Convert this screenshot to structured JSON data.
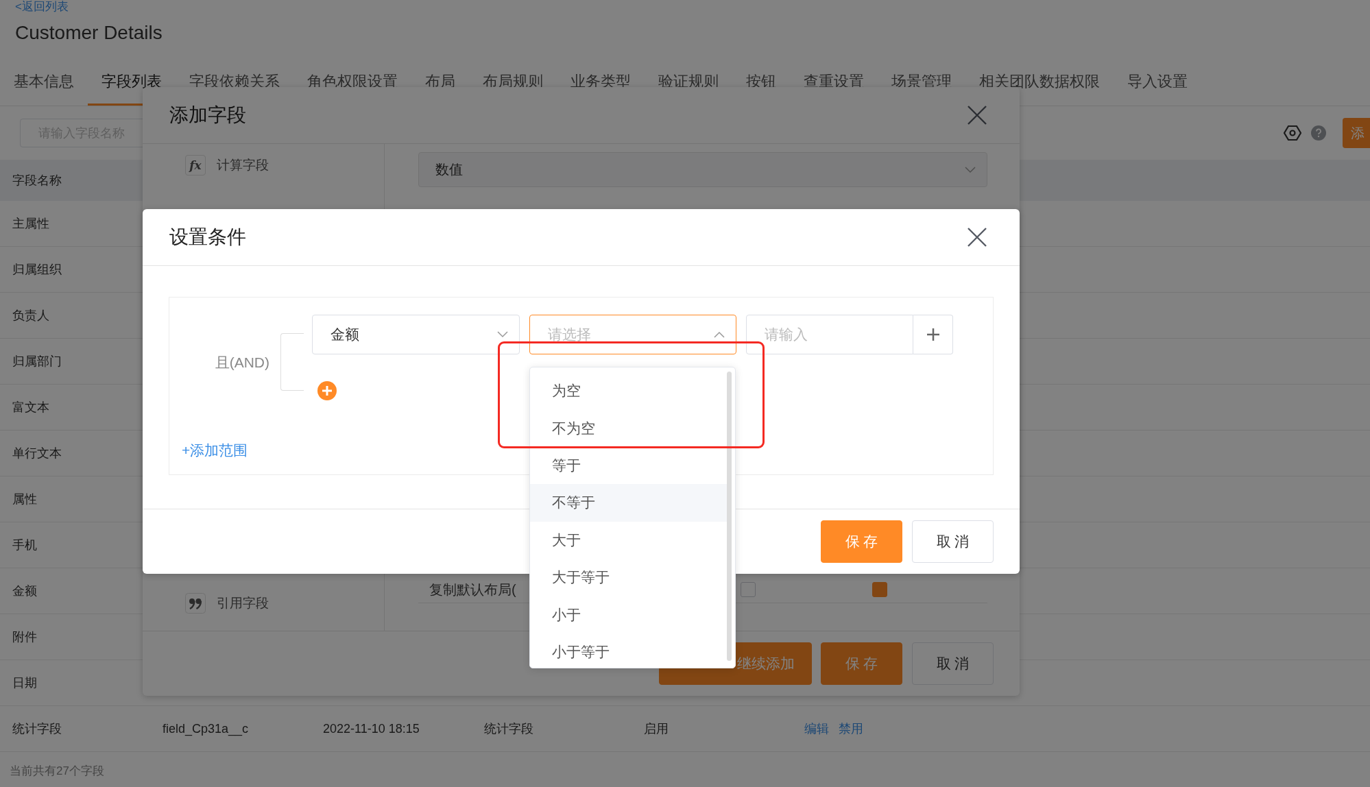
{
  "page": {
    "back_link": "<返回列表",
    "title": "Customer Details",
    "tabs": [
      {
        "label": "基本信息",
        "selected": false
      },
      {
        "label": "字段列表",
        "selected": true
      },
      {
        "label": "字段依赖关系",
        "selected": false
      },
      {
        "label": "角色权限设置",
        "selected": false
      },
      {
        "label": "布局",
        "selected": false
      },
      {
        "label": "布局规则",
        "selected": false
      },
      {
        "label": "业务类型",
        "selected": false
      },
      {
        "label": "验证规则",
        "selected": false
      },
      {
        "label": "按钮",
        "selected": false
      },
      {
        "label": "查重设置",
        "selected": false
      },
      {
        "label": "场景管理",
        "selected": false
      },
      {
        "label": "相关团队数据权限",
        "selected": false
      },
      {
        "label": "导入设置",
        "selected": false
      }
    ],
    "search": {
      "placeholder": "请输入字段名称"
    },
    "add_button": {
      "label": "添"
    },
    "table": {
      "header": "字段名称",
      "rows": [
        {
          "cells": [
            "主属性"
          ]
        },
        {
          "cells": [
            "归属组织"
          ]
        },
        {
          "cells": [
            "负责人"
          ]
        },
        {
          "cells": [
            "归属部门"
          ]
        },
        {
          "cells": [
            "富文本"
          ]
        },
        {
          "cells": [
            "单行文本"
          ]
        },
        {
          "cells": [
            "属性"
          ]
        },
        {
          "cells": [
            "手机"
          ]
        },
        {
          "cells": [
            "金额"
          ]
        },
        {
          "cells": [
            "附件"
          ]
        },
        {
          "cells": [
            "日期"
          ]
        },
        {
          "cells": [
            "统计字段",
            "field_Cp31a__c",
            "2022-11-10 18:15",
            "统计字段",
            "启用"
          ],
          "actions": [
            "编辑",
            "禁用"
          ]
        }
      ]
    },
    "summary": "当前共有27个字段"
  },
  "add_field_dialog": {
    "title": "添加字段",
    "field_types": [
      {
        "kind": "formula",
        "icon_text": "fx",
        "label": "计算字段"
      },
      {
        "kind": "reference",
        "label": "引用字段"
      }
    ],
    "type_select": {
      "value": "数值"
    },
    "layout_option": {
      "label": "复制默认布局(",
      "checkboxes": [
        {
          "checked": false
        },
        {
          "checked": true
        }
      ]
    },
    "buttons": [
      {
        "kind": "primary",
        "label": "继续添加"
      },
      {
        "kind": "primary",
        "label": "保 存"
      },
      {
        "kind": "default",
        "label": "取 消"
      }
    ]
  },
  "condition_dialog": {
    "title": "设置条件",
    "logic_label": "且(AND)",
    "field_select": {
      "value": "金额",
      "expanded": false
    },
    "operator_select": {
      "placeholder": "请选择",
      "expanded": true
    },
    "value_input": {
      "placeholder": "请输入"
    },
    "add_range_link": "+添加范围",
    "buttons": [
      {
        "kind": "primary",
        "label": "保 存"
      },
      {
        "kind": "default",
        "label": "取 消"
      }
    ],
    "operator_options": [
      {
        "label": "为空",
        "highlighted": false
      },
      {
        "label": "不为空",
        "highlighted": false
      },
      {
        "label": "等于",
        "highlighted": false
      },
      {
        "label": "不等于",
        "highlighted": true
      },
      {
        "label": "大于",
        "highlighted": false
      },
      {
        "label": "大于等于",
        "highlighted": false
      },
      {
        "label": "小于",
        "highlighted": false
      },
      {
        "label": "小于等于",
        "highlighted": false
      }
    ]
  },
  "annotation": {
    "kind": "highlight_box"
  }
}
